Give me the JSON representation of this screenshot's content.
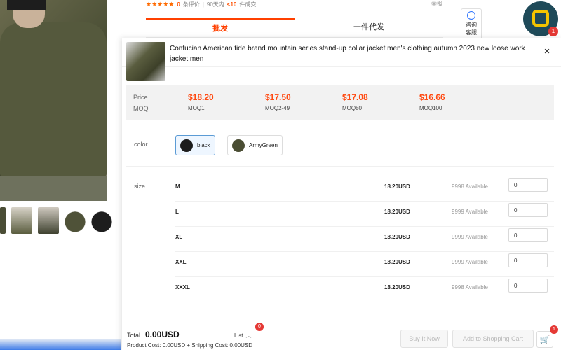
{
  "background": {
    "rating_count_label": "0 条评价",
    "rating_count_num": "0",
    "rating_count_text": "条评价",
    "sales_text_prefix": "90天内",
    "sales_highlight": "<10",
    "sales_text_suffix": "件成交",
    "report_label": "举报",
    "tabs": [
      {
        "label": "批发"
      },
      {
        "label": "一件代发"
      }
    ],
    "consult_label_1": "咨询",
    "consult_label_2": "客服",
    "fab_badge": "1"
  },
  "modal": {
    "title": "Confucian American tide brand mountain series stand-up collar jacket men's clothing autumn 2023 new loose work jacket men",
    "close_icon": "×",
    "price_label": "Price",
    "moq_label": "MOQ",
    "price_tiers": [
      {
        "price": "$18.20",
        "moq": "MOQ1"
      },
      {
        "price": "$17.50",
        "moq": "MOQ2-49"
      },
      {
        "price": "$17.08",
        "moq": "MOQ50"
      },
      {
        "price": "$16.66",
        "moq": "MOQ100"
      }
    ],
    "color_label": "color",
    "colors": [
      {
        "name": "black",
        "swatch": "#1c1c1c",
        "selected": true
      },
      {
        "name": "ArmyGreen",
        "swatch": "#4a4d33",
        "selected": false
      }
    ],
    "size_label": "size",
    "sizes": [
      {
        "name": "M",
        "price": "18.20USD",
        "available": "9998 Available",
        "qty": "0"
      },
      {
        "name": "L",
        "price": "18.20USD",
        "available": "9999 Available",
        "qty": "0"
      },
      {
        "name": "XL",
        "price": "18.20USD",
        "available": "9999 Available",
        "qty": "0"
      },
      {
        "name": "XXL",
        "price": "18.20USD",
        "available": "9999 Available",
        "qty": "0"
      },
      {
        "name": "XXXL",
        "price": "18.20USD",
        "available": "9998 Available",
        "qty": "0"
      }
    ],
    "footer": {
      "total_label": "Total",
      "total_value": "0.00USD",
      "list_label": "List",
      "list_badge": "0",
      "costs_text": "Product Cost: 0.00USD + Shipping Cost: 0.00USD",
      "buy_now_label": "Buy It Now",
      "add_cart_label": "Add to Shopping Cart",
      "cart_badge": "1"
    }
  },
  "colors": {
    "accent": "#ff4a12",
    "selected_border": "#5b9bd5",
    "badge": "#e53935"
  }
}
